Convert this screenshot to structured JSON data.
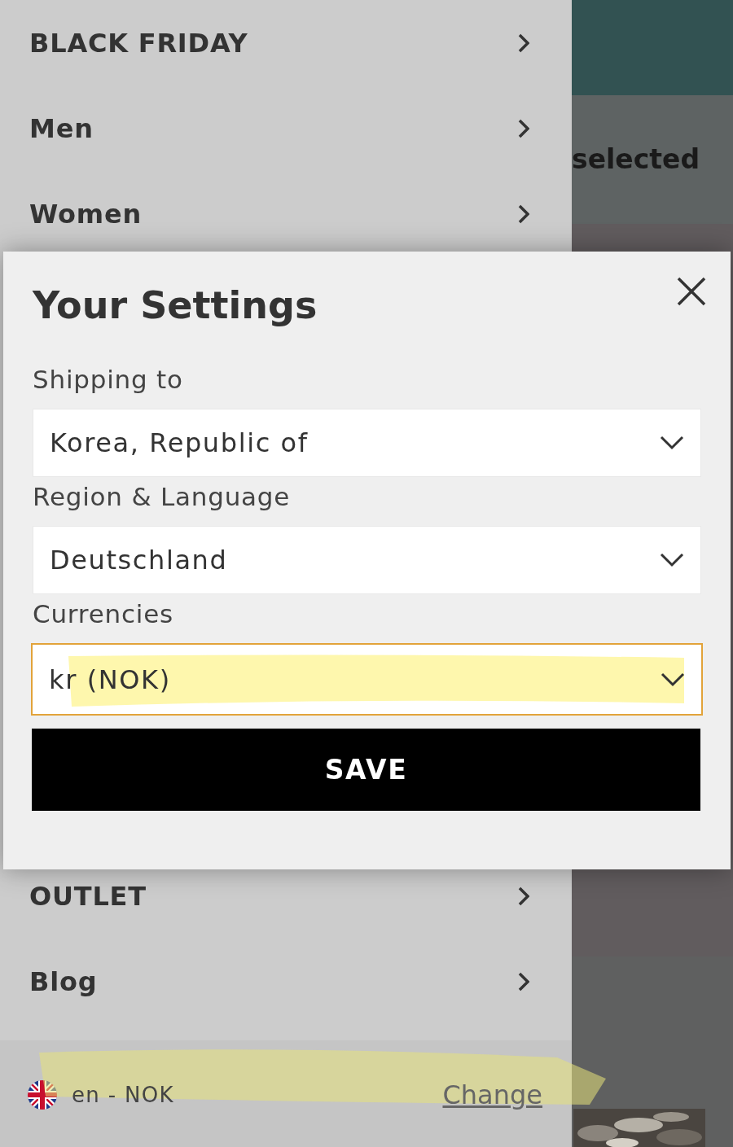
{
  "menu": {
    "items": [
      {
        "label": "BLACK FRIDAY"
      },
      {
        "label": "Men"
      },
      {
        "label": "Women"
      }
    ],
    "items_below": [
      {
        "label": "OUTLET"
      },
      {
        "label": "Blog"
      }
    ],
    "footer": {
      "locale": "en - NOK",
      "link": "Change"
    }
  },
  "background": {
    "text": "selected"
  },
  "settings_dialog": {
    "title": "Your Settings",
    "fields": [
      {
        "label": "Shipping to",
        "value": "Korea, Republic of",
        "focused": false
      },
      {
        "label": "Region & Language",
        "value": "Deutschland",
        "focused": false
      },
      {
        "label": "Currencies",
        "value": "kr (NOK)",
        "focused": true
      }
    ],
    "save_button": "SAVE"
  }
}
